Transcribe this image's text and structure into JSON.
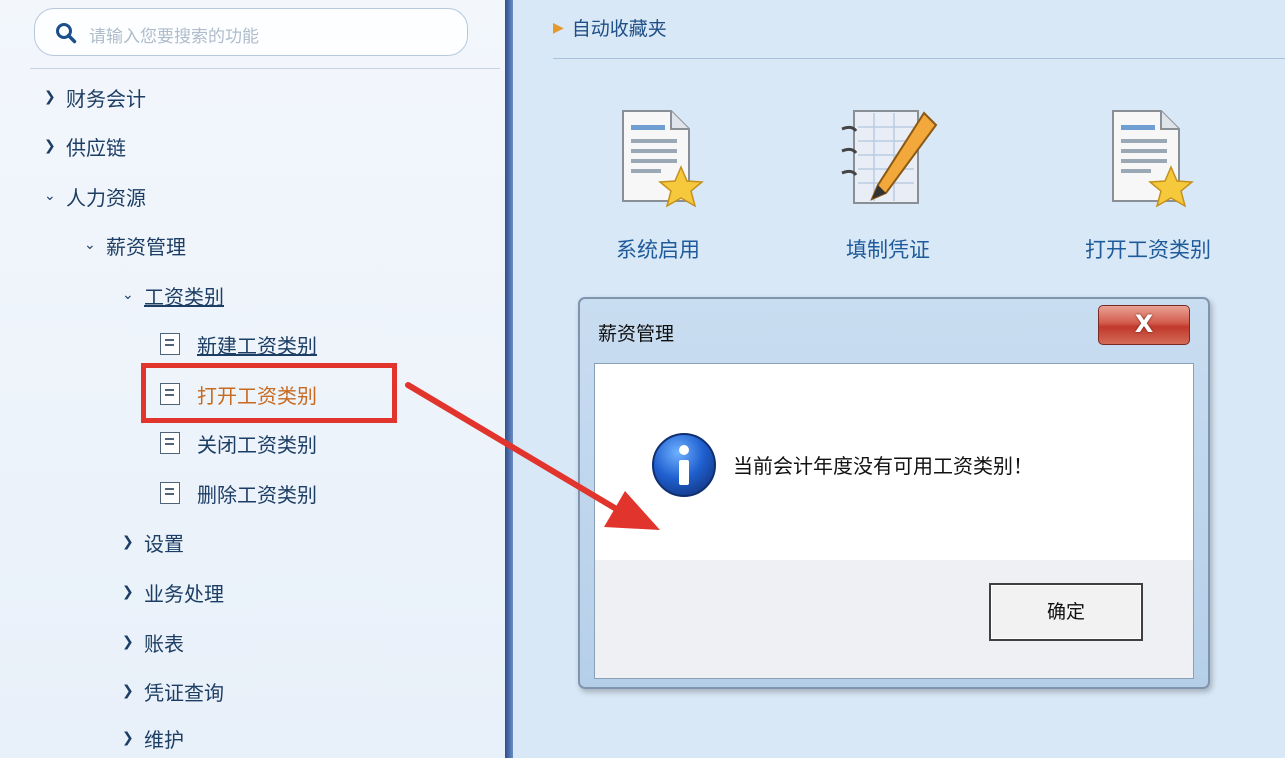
{
  "search": {
    "placeholder": "请输入您要搜索的功能",
    "icon": "search-icon"
  },
  "tree": {
    "items": [
      {
        "label": "财务会计",
        "expanded": false
      },
      {
        "label": "供应链",
        "expanded": false
      },
      {
        "label": "人力资源",
        "expanded": true
      },
      {
        "label": "薪资管理",
        "expanded": true
      },
      {
        "label": "工资类别",
        "expanded": true
      },
      {
        "label": "新建工资类别"
      },
      {
        "label": "打开工资类别",
        "selected": true
      },
      {
        "label": "关闭工资类别"
      },
      {
        "label": "删除工资类别"
      },
      {
        "label": "设置",
        "expanded": false
      },
      {
        "label": "业务处理",
        "expanded": false
      },
      {
        "label": "账表",
        "expanded": false
      },
      {
        "label": "凭证查询",
        "expanded": false
      },
      {
        "label": "维护",
        "expanded": false
      }
    ]
  },
  "content": {
    "header": "自动收藏夹",
    "shortcuts": [
      {
        "label": "系统启用",
        "icon": "document-star-icon"
      },
      {
        "label": "填制凭证",
        "icon": "notebook-pencil-icon"
      },
      {
        "label": "打开工资类别",
        "icon": "document-star-icon"
      }
    ]
  },
  "dialog": {
    "title": "薪资管理",
    "close_label": "X",
    "message": "当前会计年度没有可用工资类别！",
    "ok_label": "确定",
    "icon": "info-icon"
  },
  "colors": {
    "highlight": "#e1342d",
    "selected_text": "#c76a20",
    "link_text": "#1f5b9a",
    "nav_text": "#1d3e64"
  }
}
